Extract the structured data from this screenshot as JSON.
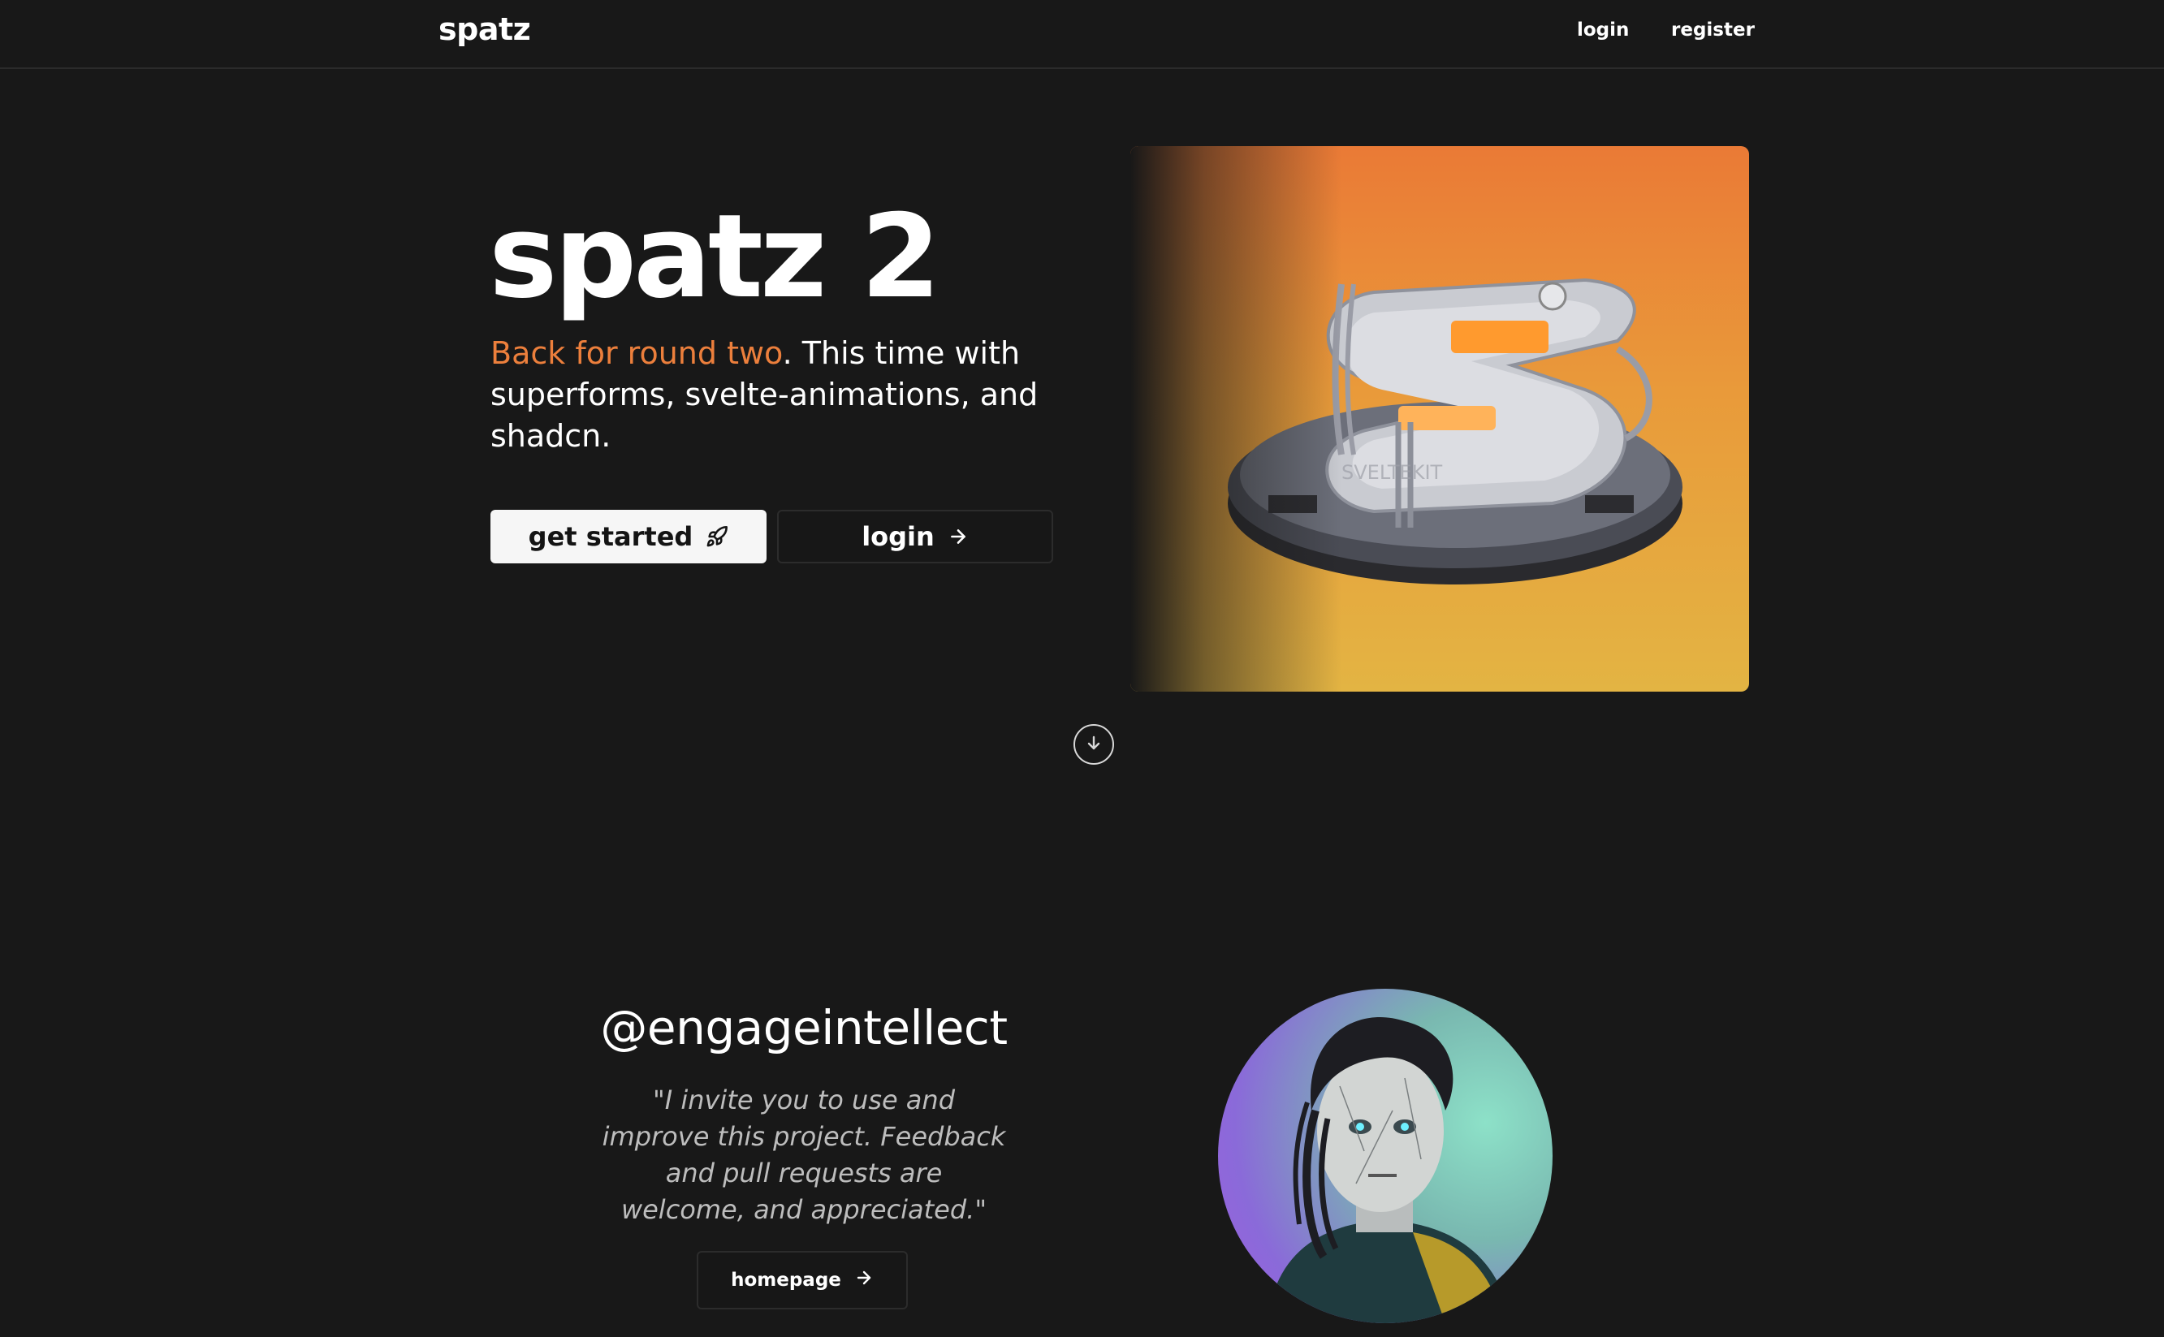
{
  "navbar": {
    "brand": "spatz",
    "login": "login",
    "register": "register"
  },
  "hero": {
    "title": "spatz 2",
    "subtitle_accent": "Back for round two",
    "subtitle_rest": ". This time with superforms, svelte-animations, and shadcn.",
    "get_started": "get started",
    "login": "login",
    "image_label": "SVELTEKIT"
  },
  "testimonial": {
    "handle": "@engageintellect",
    "quote": "\"I invite you to use and improve this project. Feedback and pull requests are welcome, and appreciated.\"",
    "homepage": "homepage"
  },
  "icons": {
    "rocket": "rocket-icon",
    "arrow_right": "arrow-right-icon",
    "scroll_down": "arrow-down-circle-icon"
  },
  "colors": {
    "background": "#181818",
    "accent": "#ec7f3c",
    "primary_button": "#f6f6f6"
  }
}
